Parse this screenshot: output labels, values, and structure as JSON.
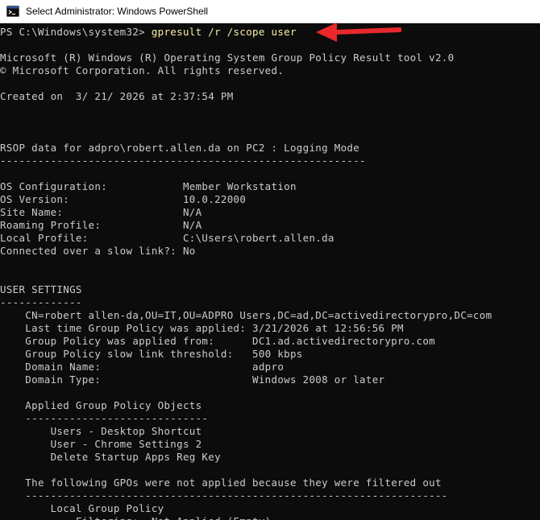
{
  "window": {
    "title": "Select Administrator: Windows PowerShell",
    "icon": "powershell-icon"
  },
  "console": {
    "prompt": "PS C:\\Windows\\system32> ",
    "command": "gpresult /r /scope user",
    "lines": [
      "",
      "Microsoft (R) Windows (R) Operating System Group Policy Result tool v2.0",
      "© Microsoft Corporation. All rights reserved.",
      "",
      "Created on  3/ 21/ 2026 at 2:37:54 PM",
      "",
      "",
      "",
      "RSOP data for adpro\\robert.allen.da on PC2 : Logging Mode",
      "----------------------------------------------------------",
      "",
      "OS Configuration:            Member Workstation",
      "OS Version:                  10.0.22000",
      "Site Name:                   N/A",
      "Roaming Profile:             N/A",
      "Local Profile:               C:\\Users\\robert.allen.da",
      "Connected over a slow link?: No",
      "",
      "",
      "USER SETTINGS",
      "-------------",
      "    CN=robert allen-da,OU=IT,OU=ADPRO Users,DC=ad,DC=activedirectorypro,DC=com",
      "    Last time Group Policy was applied: 3/21/2026 at 12:56:56 PM",
      "    Group Policy was applied from:      DC1.ad.activedirectorypro.com",
      "    Group Policy slow link threshold:   500 kbps",
      "    Domain Name:                        adpro",
      "    Domain Type:                        Windows 2008 or later",
      "",
      "    Applied Group Policy Objects",
      "    -----------------------------",
      "        Users - Desktop Shortcut",
      "        User - Chrome Settings 2",
      "        Delete Startup Apps Reg Key",
      "",
      "    The following GPOs were not applied because they were filtered out",
      "    -------------------------------------------------------------------",
      "        Local Group Policy",
      "            Filtering:  Not Applied (Empty)"
    ]
  },
  "annotation": {
    "arrow_icon": "red-arrow-icon",
    "color": "#e8282b"
  }
}
